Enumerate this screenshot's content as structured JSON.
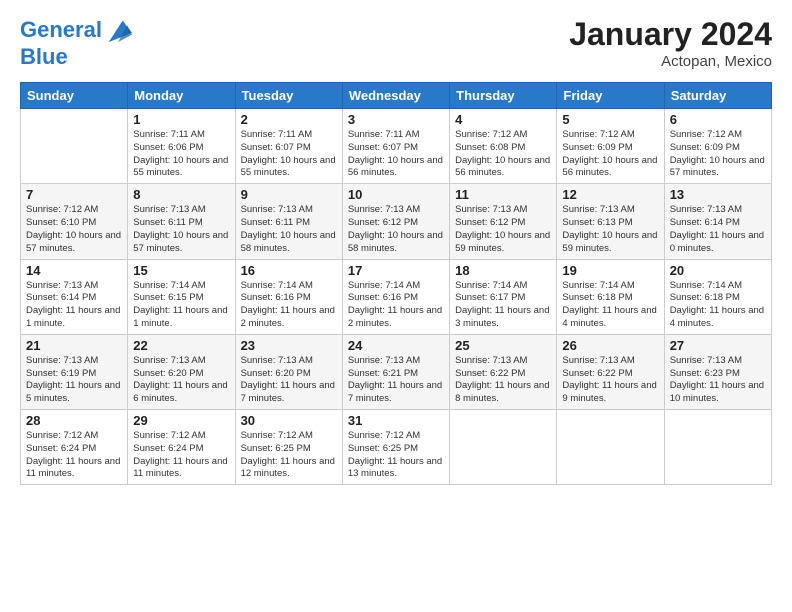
{
  "header": {
    "logo_line1": "General",
    "logo_line2": "Blue",
    "month": "January 2024",
    "location": "Actopan, Mexico"
  },
  "weekdays": [
    "Sunday",
    "Monday",
    "Tuesday",
    "Wednesday",
    "Thursday",
    "Friday",
    "Saturday"
  ],
  "weeks": [
    [
      {
        "day": "",
        "sunrise": "",
        "sunset": "",
        "daylight": ""
      },
      {
        "day": "1",
        "sunrise": "Sunrise: 7:11 AM",
        "sunset": "Sunset: 6:06 PM",
        "daylight": "Daylight: 10 hours and 55 minutes."
      },
      {
        "day": "2",
        "sunrise": "Sunrise: 7:11 AM",
        "sunset": "Sunset: 6:07 PM",
        "daylight": "Daylight: 10 hours and 55 minutes."
      },
      {
        "day": "3",
        "sunrise": "Sunrise: 7:11 AM",
        "sunset": "Sunset: 6:07 PM",
        "daylight": "Daylight: 10 hours and 56 minutes."
      },
      {
        "day": "4",
        "sunrise": "Sunrise: 7:12 AM",
        "sunset": "Sunset: 6:08 PM",
        "daylight": "Daylight: 10 hours and 56 minutes."
      },
      {
        "day": "5",
        "sunrise": "Sunrise: 7:12 AM",
        "sunset": "Sunset: 6:09 PM",
        "daylight": "Daylight: 10 hours and 56 minutes."
      },
      {
        "day": "6",
        "sunrise": "Sunrise: 7:12 AM",
        "sunset": "Sunset: 6:09 PM",
        "daylight": "Daylight: 10 hours and 57 minutes."
      }
    ],
    [
      {
        "day": "7",
        "sunrise": "Sunrise: 7:12 AM",
        "sunset": "Sunset: 6:10 PM",
        "daylight": "Daylight: 10 hours and 57 minutes."
      },
      {
        "day": "8",
        "sunrise": "Sunrise: 7:13 AM",
        "sunset": "Sunset: 6:11 PM",
        "daylight": "Daylight: 10 hours and 57 minutes."
      },
      {
        "day": "9",
        "sunrise": "Sunrise: 7:13 AM",
        "sunset": "Sunset: 6:11 PM",
        "daylight": "Daylight: 10 hours and 58 minutes."
      },
      {
        "day": "10",
        "sunrise": "Sunrise: 7:13 AM",
        "sunset": "Sunset: 6:12 PM",
        "daylight": "Daylight: 10 hours and 58 minutes."
      },
      {
        "day": "11",
        "sunrise": "Sunrise: 7:13 AM",
        "sunset": "Sunset: 6:12 PM",
        "daylight": "Daylight: 10 hours and 59 minutes."
      },
      {
        "day": "12",
        "sunrise": "Sunrise: 7:13 AM",
        "sunset": "Sunset: 6:13 PM",
        "daylight": "Daylight: 10 hours and 59 minutes."
      },
      {
        "day": "13",
        "sunrise": "Sunrise: 7:13 AM",
        "sunset": "Sunset: 6:14 PM",
        "daylight": "Daylight: 11 hours and 0 minutes."
      }
    ],
    [
      {
        "day": "14",
        "sunrise": "Sunrise: 7:13 AM",
        "sunset": "Sunset: 6:14 PM",
        "daylight": "Daylight: 11 hours and 1 minute."
      },
      {
        "day": "15",
        "sunrise": "Sunrise: 7:14 AM",
        "sunset": "Sunset: 6:15 PM",
        "daylight": "Daylight: 11 hours and 1 minute."
      },
      {
        "day": "16",
        "sunrise": "Sunrise: 7:14 AM",
        "sunset": "Sunset: 6:16 PM",
        "daylight": "Daylight: 11 hours and 2 minutes."
      },
      {
        "day": "17",
        "sunrise": "Sunrise: 7:14 AM",
        "sunset": "Sunset: 6:16 PM",
        "daylight": "Daylight: 11 hours and 2 minutes."
      },
      {
        "day": "18",
        "sunrise": "Sunrise: 7:14 AM",
        "sunset": "Sunset: 6:17 PM",
        "daylight": "Daylight: 11 hours and 3 minutes."
      },
      {
        "day": "19",
        "sunrise": "Sunrise: 7:14 AM",
        "sunset": "Sunset: 6:18 PM",
        "daylight": "Daylight: 11 hours and 4 minutes."
      },
      {
        "day": "20",
        "sunrise": "Sunrise: 7:14 AM",
        "sunset": "Sunset: 6:18 PM",
        "daylight": "Daylight: 11 hours and 4 minutes."
      }
    ],
    [
      {
        "day": "21",
        "sunrise": "Sunrise: 7:13 AM",
        "sunset": "Sunset: 6:19 PM",
        "daylight": "Daylight: 11 hours and 5 minutes."
      },
      {
        "day": "22",
        "sunrise": "Sunrise: 7:13 AM",
        "sunset": "Sunset: 6:20 PM",
        "daylight": "Daylight: 11 hours and 6 minutes."
      },
      {
        "day": "23",
        "sunrise": "Sunrise: 7:13 AM",
        "sunset": "Sunset: 6:20 PM",
        "daylight": "Daylight: 11 hours and 7 minutes."
      },
      {
        "day": "24",
        "sunrise": "Sunrise: 7:13 AM",
        "sunset": "Sunset: 6:21 PM",
        "daylight": "Daylight: 11 hours and 7 minutes."
      },
      {
        "day": "25",
        "sunrise": "Sunrise: 7:13 AM",
        "sunset": "Sunset: 6:22 PM",
        "daylight": "Daylight: 11 hours and 8 minutes."
      },
      {
        "day": "26",
        "sunrise": "Sunrise: 7:13 AM",
        "sunset": "Sunset: 6:22 PM",
        "daylight": "Daylight: 11 hours and 9 minutes."
      },
      {
        "day": "27",
        "sunrise": "Sunrise: 7:13 AM",
        "sunset": "Sunset: 6:23 PM",
        "daylight": "Daylight: 11 hours and 10 minutes."
      }
    ],
    [
      {
        "day": "28",
        "sunrise": "Sunrise: 7:12 AM",
        "sunset": "Sunset: 6:24 PM",
        "daylight": "Daylight: 11 hours and 11 minutes."
      },
      {
        "day": "29",
        "sunrise": "Sunrise: 7:12 AM",
        "sunset": "Sunset: 6:24 PM",
        "daylight": "Daylight: 11 hours and 11 minutes."
      },
      {
        "day": "30",
        "sunrise": "Sunrise: 7:12 AM",
        "sunset": "Sunset: 6:25 PM",
        "daylight": "Daylight: 11 hours and 12 minutes."
      },
      {
        "day": "31",
        "sunrise": "Sunrise: 7:12 AM",
        "sunset": "Sunset: 6:25 PM",
        "daylight": "Daylight: 11 hours and 13 minutes."
      },
      {
        "day": "",
        "sunrise": "",
        "sunset": "",
        "daylight": ""
      },
      {
        "day": "",
        "sunrise": "",
        "sunset": "",
        "daylight": ""
      },
      {
        "day": "",
        "sunrise": "",
        "sunset": "",
        "daylight": ""
      }
    ]
  ]
}
